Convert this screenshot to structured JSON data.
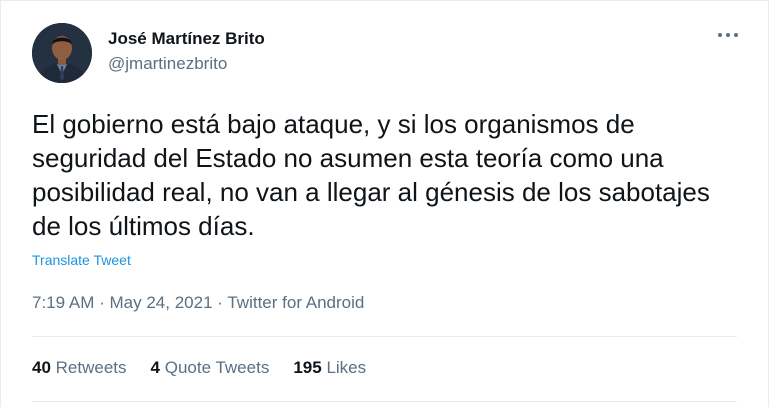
{
  "author": {
    "name": "José Martínez Brito",
    "handle": "@jmartinezbrito"
  },
  "tweet": {
    "text": "El gobierno está bajo ataque, y si los organismos de seguridad del Estado no asumen esta teoría como una posibilidad real, no van a llegar al génesis de los sabotajes de los últimos días.",
    "translate_label": "Translate Tweet",
    "time": "7:19 AM",
    "date": "May 24, 2021",
    "source": "Twitter for Android",
    "separator": "·"
  },
  "stats": {
    "retweets_count": "40",
    "retweets_label": "Retweets",
    "quotes_count": "4",
    "quotes_label": "Quote Tweets",
    "likes_count": "195",
    "likes_label": "Likes"
  },
  "icons": {
    "more": "more-icon",
    "avatar": "avatar"
  }
}
